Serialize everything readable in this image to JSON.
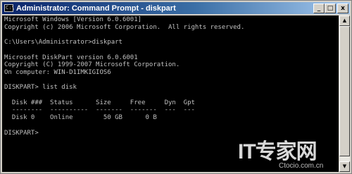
{
  "window": {
    "title": "Administrator: Command Prompt - diskpart",
    "icon_label": "C:\\",
    "minimize_glyph": "_",
    "maximize_glyph": "□",
    "close_glyph": "x",
    "titlebar_color": "#0a246a",
    "console_background": "#000000",
    "console_text_color": "#c0c0c0"
  },
  "console": {
    "lines": [
      "Microsoft Windows [Version 6.0.6001]",
      "Copyright (c) 2006 Microsoft Corporation.  All rights reserved.",
      "",
      "C:\\Users\\Administrator>diskpart",
      "",
      "Microsoft DiskPart version 6.0.6001",
      "Copyright (C) 1999-2007 Microsoft Corporation.",
      "On computer: WIN-D1IMKIGIOS6",
      "",
      "DISKPART> list disk",
      "",
      "  Disk ###  Status      Size     Free     Dyn  Gpt",
      "  --------  ----------  -------  -------  ---  ---",
      "  Disk 0    Online        50 GB      0 B",
      "",
      "DISKPART>"
    ]
  },
  "scrollbar": {
    "up_glyph": "▲",
    "down_glyph": "▼"
  },
  "watermark": {
    "logo_text": "IT专家网",
    "url": "Ctocio.com.cn"
  }
}
